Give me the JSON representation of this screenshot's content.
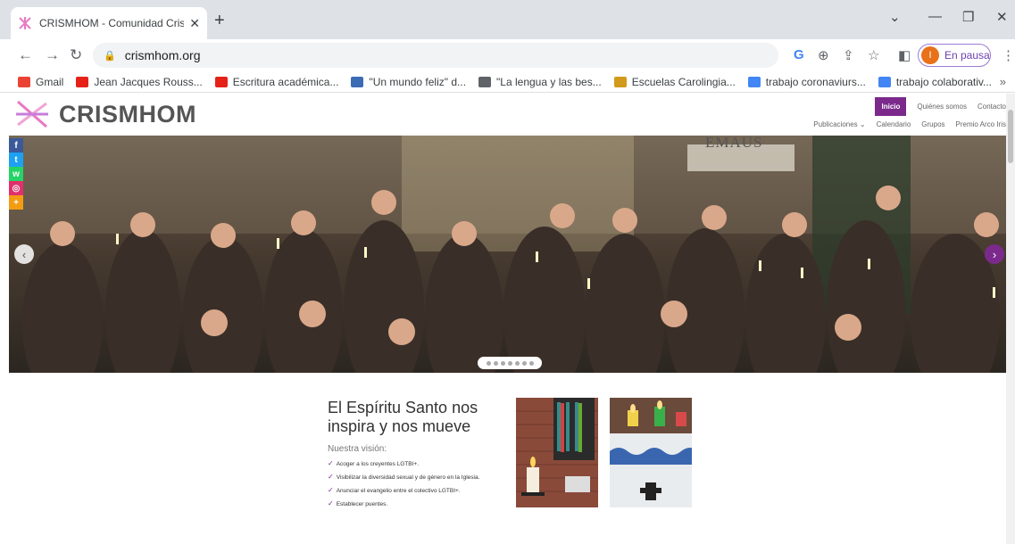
{
  "browser": {
    "tab_title": "CRISMHOM - Comunidad Cristiar",
    "url": "crismhom.org",
    "profile_initial": "I",
    "profile_label": "En pausa",
    "bookmarks": [
      {
        "label": "Gmail",
        "icon": "gmail-icon",
        "color": "#ea4335"
      },
      {
        "label": "Jean Jacques Rouss...",
        "icon": "youtube-icon",
        "color": "#e62117"
      },
      {
        "label": "Escritura académica...",
        "icon": "youtube-icon",
        "color": "#e62117"
      },
      {
        "label": "\"Un mundo feliz\" d...",
        "icon": "page-icon",
        "color": "#3b6cb4"
      },
      {
        "label": "\"La lengua y las bes...",
        "icon": "globe-icon",
        "color": "#5f6368"
      },
      {
        "label": "Escuelas Carolingia...",
        "icon": "site-icon",
        "color": "#d19a1a"
      },
      {
        "label": "trabajo coronaviurs...",
        "icon": "docs-icon",
        "color": "#4285f4"
      },
      {
        "label": "trabajo colaborativ...",
        "icon": "docs-icon",
        "color": "#4285f4"
      }
    ]
  },
  "site": {
    "logo_text": "CRISMHOM",
    "brand_color": "#7b2a8c",
    "top_nav": [
      "Inicio",
      "Quiénes somos",
      "Contacto"
    ],
    "sub_nav": [
      "Publicaciones  ⌄",
      "Calendario",
      "Grupos",
      "Premio Arco Iris"
    ],
    "social": [
      {
        "icon": "facebook-icon",
        "glyph": "f",
        "color": "#3b5998"
      },
      {
        "icon": "twitter-icon",
        "glyph": "t",
        "color": "#1da1f2"
      },
      {
        "icon": "whatsapp-icon",
        "glyph": "w",
        "color": "#25d366"
      },
      {
        "icon": "instagram-icon",
        "glyph": "◎",
        "color": "#e1306c"
      },
      {
        "icon": "share-plus-icon",
        "glyph": "+",
        "color": "#f39c12"
      }
    ],
    "hero_sign": "EMAUS",
    "vision": {
      "heading": "El Espíritu Santo nos inspira y nos mueve",
      "subheading": "Nuestra visión:",
      "items": [
        "Acoger a los creyentes LGTBI+.",
        "Visibilizar la diversidad sexual y de género en la Iglesia.",
        "Anunciar el evangelio entre el colectivo LGTBI+.",
        "Establecer puentes."
      ]
    }
  }
}
